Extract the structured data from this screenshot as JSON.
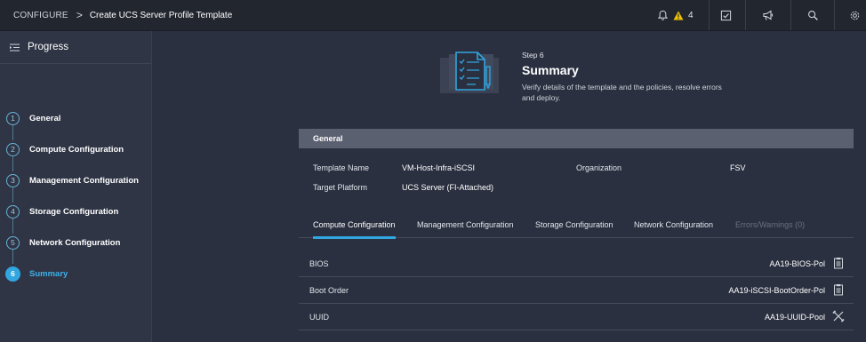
{
  "header": {
    "root": "CONFIGURE",
    "separator": ">",
    "page_title": "Create UCS Server Profile Template",
    "alert_count": "4",
    "icons": [
      "bell-icon",
      "warning-icon",
      "tasks-icon",
      "announcement-icon",
      "search-icon",
      "settings-icon"
    ]
  },
  "sidebar": {
    "title": "Progress",
    "steps": [
      {
        "num": "1",
        "label": "General"
      },
      {
        "num": "2",
        "label": "Compute Configuration"
      },
      {
        "num": "3",
        "label": "Management Configuration"
      },
      {
        "num": "4",
        "label": "Storage Configuration"
      },
      {
        "num": "5",
        "label": "Network Configuration"
      },
      {
        "num": "6",
        "label": "Summary"
      }
    ],
    "active_step": 6
  },
  "summary": {
    "step": "Step 6",
    "title": "Summary",
    "description": "Verify details of the template and the policies, resolve errors and deploy."
  },
  "general": {
    "section_title": "General",
    "template_name_label": "Template Name",
    "template_name": "VM-Host-Infra-iSCSI",
    "organization_label": "Organization",
    "organization": "FSV",
    "target_platform_label": "Target Platform",
    "target_platform": "UCS Server (FI-Attached)"
  },
  "tabs": [
    {
      "label": "Compute Configuration",
      "state": "active"
    },
    {
      "label": "Management Configuration",
      "state": "normal"
    },
    {
      "label": "Storage Configuration",
      "state": "normal"
    },
    {
      "label": "Network Configuration",
      "state": "normal"
    },
    {
      "label": "Errors/Warnings (0)",
      "state": "disabled"
    }
  ],
  "policies": [
    {
      "name": "BIOS",
      "value": "AA19-BIOS-Pol",
      "icon": "clipboard-icon"
    },
    {
      "name": "Boot Order",
      "value": "AA19-iSCSI-BootOrder-Pol",
      "icon": "clipboard-icon"
    },
    {
      "name": "UUID",
      "value": "AA19-UUID-Pool",
      "icon": "tools-icon"
    }
  ],
  "colors": {
    "accent": "#31a6e0",
    "background": "#2b3040",
    "sidebar": "#2f3545",
    "topbar": "#22262f",
    "warning": "#f2c200"
  }
}
